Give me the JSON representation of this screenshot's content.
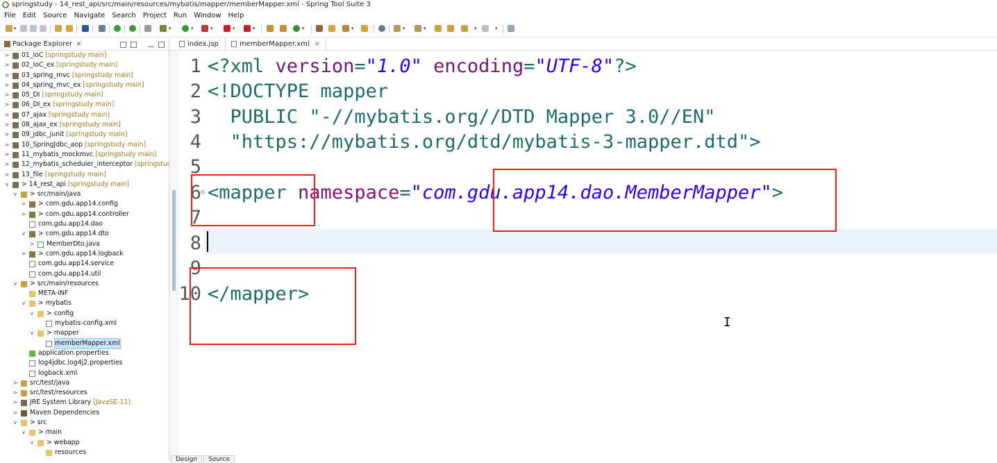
{
  "window": {
    "title": "springstudy - 14_rest_api/src/main/resources/mybatis/mapper/memberMapper.xml - Spring Tool Suite 3"
  },
  "menu": [
    "File",
    "Edit",
    "Source",
    "Navigate",
    "Search",
    "Project",
    "Run",
    "Window",
    "Help"
  ],
  "package_explorer": {
    "tab_label": "Package Explorer",
    "close": "×",
    "tree": [
      {
        "label": "01_IoC",
        "suffix": " [springstudy main]",
        "depth": 0,
        "twisty": ">",
        "icon": "project-icon"
      },
      {
        "label": "02_IoC_ex",
        "suffix": " [springstudy main]",
        "depth": 0,
        "twisty": ">",
        "icon": "project-icon"
      },
      {
        "label": "03_spring_mvc",
        "suffix": " [springstudy main]",
        "depth": 0,
        "twisty": ">",
        "icon": "project-icon"
      },
      {
        "label": "04_spring_mvc_ex",
        "suffix": " [springstudy main]",
        "depth": 0,
        "twisty": ">",
        "icon": "project-icon"
      },
      {
        "label": "05_DI",
        "suffix": " [springstudy main]",
        "depth": 0,
        "twisty": ">",
        "icon": "project-icon"
      },
      {
        "label": "06_DI_ex",
        "suffix": " [springstudy main]",
        "depth": 0,
        "twisty": ">",
        "icon": "project-icon"
      },
      {
        "label": "07_ajax",
        "suffix": " [springstudy main]",
        "depth": 0,
        "twisty": ">",
        "icon": "project-icon"
      },
      {
        "label": "08_ajax_ex",
        "suffix": " [springstudy main]",
        "depth": 0,
        "twisty": ">",
        "icon": "project-icon"
      },
      {
        "label": "09_jdbc_junit",
        "suffix": " [springstudy main]",
        "depth": 0,
        "twisty": ">",
        "icon": "project-icon"
      },
      {
        "label": "10_SpringJdbc_aop",
        "suffix": " [springstudy main]",
        "depth": 0,
        "twisty": ">",
        "icon": "project-icon"
      },
      {
        "label": "11_mybatis_mockmvc",
        "suffix": " [springstudy main]",
        "depth": 0,
        "twisty": ">",
        "icon": "project-icon"
      },
      {
        "label": "12_mybatis_scheduler_interceptor",
        "suffix": " [springstudy m",
        "depth": 0,
        "twisty": ">",
        "icon": "project-icon"
      },
      {
        "label": "13_file",
        "suffix": " [springstudy main]",
        "depth": 0,
        "twisty": ">",
        "icon": "project-icon"
      },
      {
        "label": "> 14_rest_api",
        "suffix": " [springstudy main]",
        "depth": 0,
        "twisty": "v",
        "icon": "project-icon"
      },
      {
        "label": "> src/main/java",
        "suffix": "",
        "depth": 1,
        "twisty": "v",
        "icon": "source-folder-icon"
      },
      {
        "label": "> com.gdu.app14.config",
        "suffix": "",
        "depth": 2,
        "twisty": ">",
        "icon": "package-icon"
      },
      {
        "label": "> com.gdu.app14.controller",
        "suffix": "",
        "depth": 2,
        "twisty": ">",
        "icon": "package-icon"
      },
      {
        "label": "com.gdu.app14.dao",
        "suffix": "",
        "depth": 2,
        "twisty": "",
        "icon": "empty-package-icon"
      },
      {
        "label": "> com.gdu.app14.dto",
        "suffix": "",
        "depth": 2,
        "twisty": "v",
        "icon": "package-icon"
      },
      {
        "label": "MemberDto.java",
        "suffix": "",
        "depth": 3,
        "twisty": ">",
        "icon": "java-file-icon"
      },
      {
        "label": "> com.gdu.app14.logback",
        "suffix": "",
        "depth": 2,
        "twisty": ">",
        "icon": "package-icon"
      },
      {
        "label": "com.gdu.app14.service",
        "suffix": "",
        "depth": 2,
        "twisty": "",
        "icon": "empty-package-icon"
      },
      {
        "label": "com.gdu.app14.util",
        "suffix": "",
        "depth": 2,
        "twisty": "",
        "icon": "empty-package-icon"
      },
      {
        "label": "> src/main/resources",
        "suffix": "",
        "depth": 1,
        "twisty": "v",
        "icon": "source-folder-icon"
      },
      {
        "label": "META-INF",
        "suffix": "",
        "depth": 2,
        "twisty": "",
        "icon": "folder-icon"
      },
      {
        "label": "> mybatis",
        "suffix": "",
        "depth": 2,
        "twisty": "v",
        "icon": "folder-icon"
      },
      {
        "label": "> config",
        "suffix": "",
        "depth": 3,
        "twisty": "v",
        "icon": "folder-icon"
      },
      {
        "label": "mybatis-config.xml",
        "suffix": "",
        "depth": 4,
        "twisty": "",
        "icon": "xml-file-icon"
      },
      {
        "label": "> mapper",
        "suffix": "",
        "depth": 3,
        "twisty": "v",
        "icon": "folder-icon"
      },
      {
        "label": "memberMapper.xml",
        "suffix": "",
        "depth": 4,
        "twisty": "",
        "icon": "xml-file-icon",
        "selected": true
      },
      {
        "label": "application.properties",
        "suffix": "",
        "depth": 2,
        "twisty": "",
        "icon": "properties-file-icon"
      },
      {
        "label": "log4jdbc.log4j2.properties",
        "suffix": "",
        "depth": 2,
        "twisty": "",
        "icon": "file-icon"
      },
      {
        "label": "logback.xml",
        "suffix": "",
        "depth": 2,
        "twisty": "",
        "icon": "xml-file-icon"
      },
      {
        "label": "src/test/java",
        "suffix": "",
        "depth": 1,
        "twisty": ">",
        "icon": "source-folder-icon"
      },
      {
        "label": "src/test/resources",
        "suffix": "",
        "depth": 1,
        "twisty": ">",
        "icon": "source-folder-icon"
      },
      {
        "label": "JRE System Library",
        "suffix": " [JavaSE-11]",
        "depth": 1,
        "twisty": ">",
        "icon": "library-icon"
      },
      {
        "label": "Maven Dependencies",
        "suffix": "",
        "depth": 1,
        "twisty": ">",
        "icon": "maven-icon"
      },
      {
        "label": "> src",
        "suffix": "",
        "depth": 1,
        "twisty": "v",
        "icon": "folder-icon"
      },
      {
        "label": "> main",
        "suffix": "",
        "depth": 2,
        "twisty": "v",
        "icon": "folder-icon"
      },
      {
        "label": "> webapp",
        "suffix": "",
        "depth": 3,
        "twisty": "v",
        "icon": "folder-icon"
      },
      {
        "label": "resources",
        "suffix": "",
        "depth": 4,
        "twisty": "",
        "icon": "folder-icon"
      }
    ]
  },
  "editor": {
    "tabs": [
      {
        "label": "index.jsp",
        "active": false
      },
      {
        "label": "memberMapper.xml",
        "active": true
      }
    ],
    "close": "×",
    "lines": [
      {
        "num": "1",
        "tokens": [
          [
            "tag",
            "<?xml "
          ],
          [
            "attr",
            "version"
          ],
          [
            "tag",
            "="
          ],
          [
            "str",
            "\"1.0\""
          ],
          [
            "tag",
            " "
          ],
          [
            "attr",
            "encoding"
          ],
          [
            "tag",
            "="
          ],
          [
            "str",
            "\"UTF-8\""
          ],
          [
            "tag",
            "?>"
          ]
        ]
      },
      {
        "num": "2",
        "tokens": [
          [
            "tag",
            "<!DOCTYPE mapper"
          ]
        ]
      },
      {
        "num": "3",
        "tokens": [
          [
            "tag",
            "  PUBLIC "
          ],
          [
            "dstr",
            "\"-//mybatis.org//DTD Mapper 3.0//EN\""
          ]
        ]
      },
      {
        "num": "4",
        "tokens": [
          [
            "dstr",
            "  \"https://mybatis.org/dtd/mybatis-3-mapper.dtd\""
          ],
          [
            "tag",
            ">"
          ]
        ]
      },
      {
        "num": "5",
        "tokens": []
      },
      {
        "num": "6",
        "tokens": [
          [
            "tag",
            "<mapper "
          ],
          [
            "attr",
            "namespace"
          ],
          [
            "tag",
            "="
          ],
          [
            "str",
            "\"com.gdu.app14.dao.MemberMapper\""
          ],
          [
            "tag",
            ">"
          ]
        ],
        "fold": "⊖"
      },
      {
        "num": "7",
        "tokens": []
      },
      {
        "num": "8",
        "tokens": []
      },
      {
        "num": "9",
        "tokens": []
      },
      {
        "num": "10",
        "tokens": [
          [
            "tag",
            "</mapper>"
          ]
        ]
      }
    ]
  },
  "bottom_tabs": [
    "Design",
    "Source"
  ],
  "colors": {
    "tag": "#1d6c6a",
    "attr": "#7a137a",
    "string": "#2a00ff",
    "annotation_box": "#ff1a1a"
  }
}
